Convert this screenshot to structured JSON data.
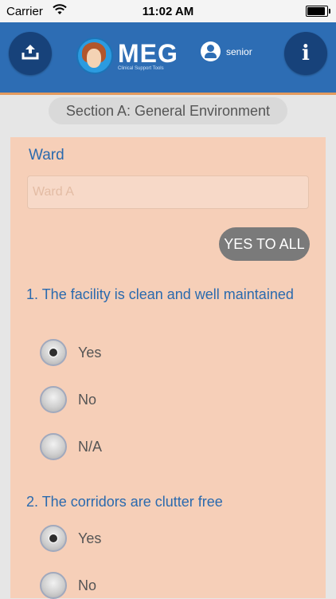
{
  "status_bar": {
    "carrier": "Carrier",
    "time": "11:02 AM",
    "wifi_icon": "wifi-icon",
    "battery_icon": "battery-icon"
  },
  "header": {
    "upload_icon": "upload-icon",
    "info_icon": "info-icon",
    "info_glyph": "i",
    "logo": {
      "name": "MEG",
      "subtitle": "Clinical Support Tools"
    },
    "user": {
      "icon": "user-icon",
      "name": "senior"
    },
    "colors": {
      "bar": "#2d6db4",
      "button": "#17427a",
      "accent_line": "#e39a5e"
    }
  },
  "section": {
    "title": "Section A: General Environment"
  },
  "form": {
    "ward_label": "Ward",
    "ward_placeholder": "Ward A",
    "ward_value": "",
    "yes_to_all_label": "YES TO ALL",
    "panel_color": "#f6cfb8",
    "questions": [
      {
        "text": "1. The facility is clean and well maintained",
        "options": [
          {
            "label": "Yes",
            "checked": true
          },
          {
            "label": "No",
            "checked": false
          },
          {
            "label": "N/A",
            "checked": false
          }
        ]
      },
      {
        "text": "2. The corridors are clutter free",
        "options": [
          {
            "label": "Yes",
            "checked": true
          },
          {
            "label": "No",
            "checked": false
          }
        ]
      }
    ]
  }
}
